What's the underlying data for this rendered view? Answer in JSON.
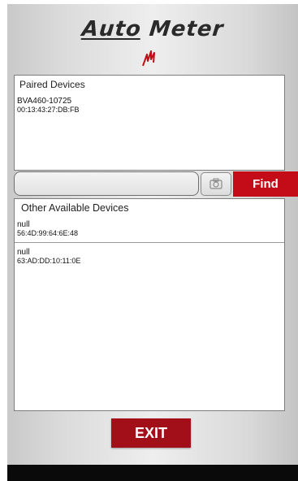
{
  "app": {
    "logo_text_part1": "Auto",
    "logo_text_part2": "Meter",
    "brand_color": "#c30c18"
  },
  "paired": {
    "header": "Paired Devices",
    "devices": [
      {
        "name": "BVA460-10725",
        "address": "00:13:43:27:DB:FB"
      }
    ]
  },
  "search": {
    "value": "",
    "camera_icon": "camera-icon",
    "find_label": "Find"
  },
  "other": {
    "header": "Other Available Devices",
    "devices": [
      {
        "name": "null",
        "address": "56:4D:99:64:6E:48"
      },
      {
        "name": "null",
        "address": "63:AD:DD:10:11:0E"
      }
    ]
  },
  "footer": {
    "exit_label": "EXIT"
  }
}
